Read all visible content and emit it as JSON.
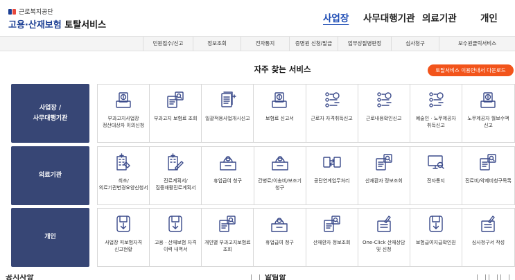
{
  "header": {
    "org_name": "근로복지공단",
    "brand_main": "고용·산재보험",
    "brand_sub": "토탈서비스",
    "nav": [
      {
        "label": "사업장",
        "active": true
      },
      {
        "label": "사무대행기관",
        "active": false
      },
      {
        "label": "의료기관",
        "active": false
      },
      {
        "label": "개인",
        "active": false
      }
    ]
  },
  "subnav": [
    "민원접수/신고",
    "정보조회",
    "전자통지",
    "증명원 신청/발급",
    "업무상질병판정",
    "심사청구",
    "보수원클릭서비스"
  ],
  "main": {
    "section_title": "자주 찾는 서비스",
    "download_button": "토탈서비스 이용안내서 다운로드"
  },
  "rows": [
    {
      "label": "사업장 /\n사무대행기관",
      "items": [
        {
          "label": "부과고지사업장 정산대상자 이의신청",
          "icon": "money-monitor-icon"
        },
        {
          "label": "부과고지 보험료 조회",
          "icon": "document-search-icon"
        },
        {
          "label": "일괄적용사업개시신고",
          "icon": "document-stack-icon"
        },
        {
          "label": "보험료 신고서",
          "icon": "money-monitor-icon"
        },
        {
          "label": "근로자 자격취득신고",
          "icon": "people-network-icon"
        },
        {
          "label": "근로내용확인신고",
          "icon": "people-network-icon"
        },
        {
          "label": "예술인 · 노무제공자 취득신고",
          "icon": "people-network-icon"
        },
        {
          "label": "노무제공자 월보수액 신고",
          "icon": "money-monitor-icon"
        }
      ]
    },
    {
      "label": "의료기관",
      "items": [
        {
          "label": "최초/의료기관변경요양신청서",
          "icon": "hospital-building-icon"
        },
        {
          "label": "진료계획서/집중재활진료계획서",
          "icon": "hospital-edit-icon"
        },
        {
          "label": "휴업급여 청구",
          "icon": "money-box-icon"
        },
        {
          "label": "간병료/이송비/보조기 청구",
          "icon": "money-box-icon"
        },
        {
          "label": "공단연계업무처리",
          "icon": "file-exchange-icon"
        },
        {
          "label": "산재환자 정보조회",
          "icon": "document-search-icon"
        },
        {
          "label": "전자통지",
          "icon": "monitor-search-icon"
        },
        {
          "label": "진료비/약제비청구목록",
          "icon": "document-search-icon"
        }
      ]
    },
    {
      "label": "개인",
      "items": [
        {
          "label": "사업장 피보험자격 신고현황",
          "icon": "download-doc-icon"
        },
        {
          "label": "고용 · 산재보험 자격 이력 내역서",
          "icon": "download-doc-icon"
        },
        {
          "label": "개인별 부과고지보험료 조회",
          "icon": "document-search-icon"
        },
        {
          "label": "휴업급여 청구",
          "icon": "money-box-icon"
        },
        {
          "label": "산재환자 정보조회",
          "icon": "document-search-icon"
        },
        {
          "label": "One-Click 산재상담 및 신청",
          "icon": "document-pen-icon"
        },
        {
          "label": "보험급여지급확인원",
          "icon": "download-doc-icon"
        },
        {
          "label": "심사청구서 작성",
          "icon": "document-pen-icon"
        }
      ]
    }
  ],
  "bottom": {
    "left_title": "공지사항",
    "center_title": "알림함"
  },
  "colors": {
    "brand_blue": "#1c3f94",
    "row_label_bg": "#374675",
    "accent_orange": "#f2541b",
    "icon_blue": "#3a4a8a"
  }
}
